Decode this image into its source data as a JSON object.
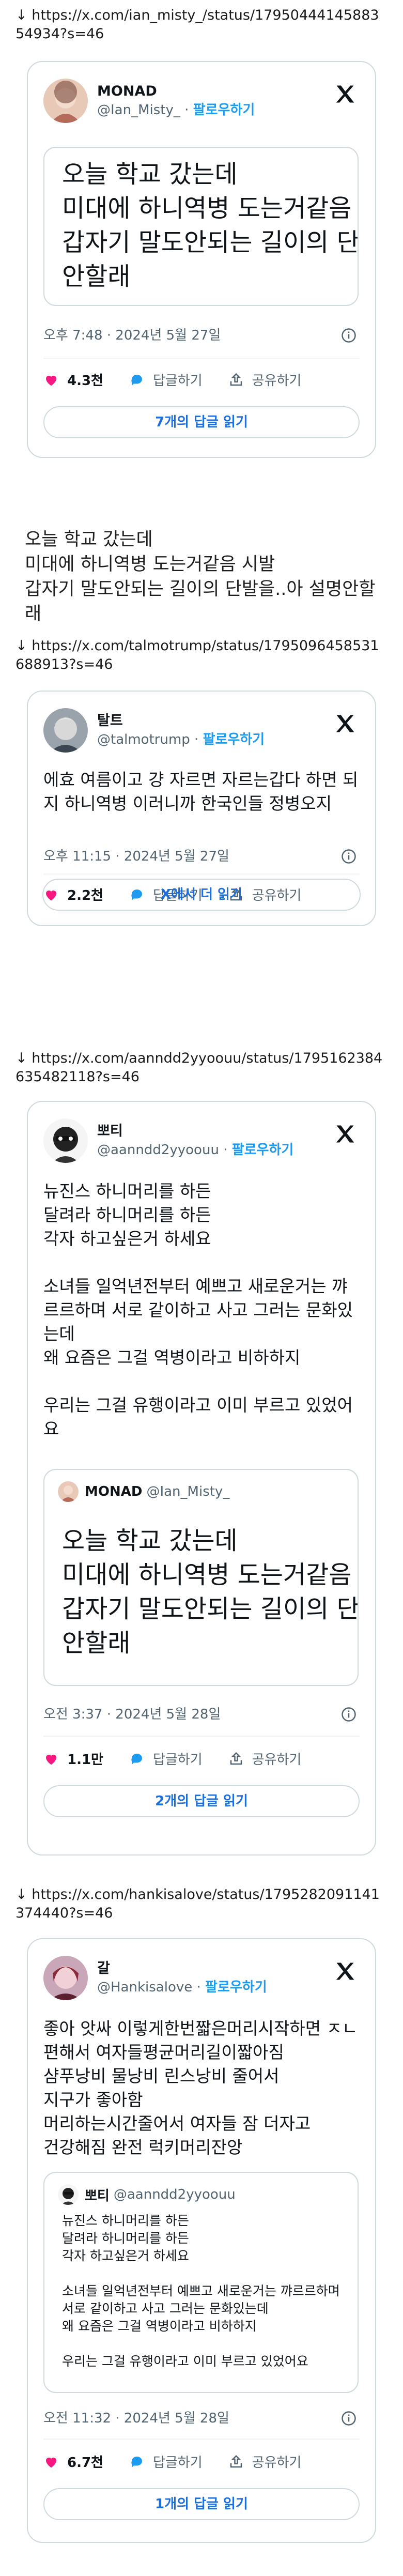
{
  "links": [
    "↓ https://x.com/ian_misty_/status/1795044414588354934?s=46",
    "↓ https://x.com/talmotrump/status/1795096458531688913?s=46",
    "↓ https://x.com/aanndd2yyoouu/status/1795162384635482118?s=46",
    "↓ https://x.com/hankisalove/status/1795282091141374440?s=46"
  ],
  "follow_label": "팔로우하기",
  "reply_label": "답글하기",
  "share_label": "공유하기",
  "separator": "·",
  "tweets": [
    {
      "display_name": "MONAD",
      "handle": "@Ian_Misty_",
      "big_text": "오늘 학교 갔는데\n미대에 하니역병 도는거같음 시발\n갑자기 말도안되는 길이의 단발을\n안할래",
      "time": "오후 7:48 · 2024년 5월 27일",
      "likes": "4.3천",
      "read_more": "7개의 답글 읽기"
    },
    {
      "display_name": "탈트",
      "handle": "@talmotrump",
      "text": "에효 여름이고 걍 자르면 자르는갑다 하면 되지 하니역병 이러니까 한국인들 정병오지",
      "time": "오후 11:15 · 2024년 5월 27일",
      "likes": "2.2천",
      "read_more": "X에서 더 읽기"
    },
    {
      "display_name": "뽀티",
      "handle": "@aanndd2yyoouu",
      "text": "뉴진스 하니머리를 하든\n달려라 하니머리를 하든\n각자 하고싶은거 하세요\n\n소녀들 일억년전부터 예쁘고 새로운거는 꺄르르하며 서로 같이하고 사고 그러는 문화있는데\n왜 요즘은 그걸 역병이라고 비하하지\n\n우리는 그걸 유행이라고 이미 부르고 있었어요",
      "quote_name": "MONAD",
      "quote_handle": "@Ian_Misty_",
      "quote_text": "오늘 학교 갔는데\n미대에 하니역병 도는거같음 시발\n갑자기 말도안되는 길이의 단발을\n안할래",
      "time": "오전 3:37 · 2024년 5월 28일",
      "likes": "1.1만",
      "read_more": "2개의 답글 읽기"
    },
    {
      "display_name": "갈",
      "handle": "@Hankisalove",
      "text": "좋아 앗싸 이렇게한번짧은머리시작하면 ㅈㄴ편해서 여자들평균머리길이짧아짐\n샴푸낭비 물낭비 린스낭비 줄어서\n지구가 좋아함\n머리하는시간줄어서 여자들 잠 더자고\n건강해짐 완전 럭키머리잔앙",
      "quote_name": "뽀티",
      "quote_handle": "@aanndd2yyoouu",
      "quote_text": "뉴진스 하니머리를 하든\n달려라 하니머리를 하든\n각자 하고싶은거 하세요\n\n소녀들 일억년전부터 예쁘고 새로운거는 꺄르르하며 서로 같이하고 사고 그러는 문화있는데\n왜 요즘은 그걸 역병이라고 비하하지\n\n우리는 그걸 유행이라고 이미 부르고 있었어요",
      "time": "오전 11:32 · 2024년 5월 28일",
      "likes": "6.7천",
      "read_more": "1개의 답글 읽기"
    }
  ],
  "standalone_text": "오늘 학교 갔는데\n미대에 하니역병 도는거같음 시발\n갑자기 말도안되는 길이의 단발을..아 설명안할래"
}
